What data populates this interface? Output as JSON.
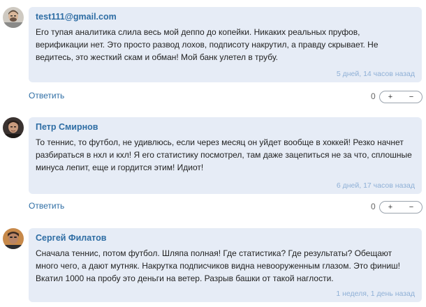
{
  "comments": [
    {
      "author": "test111@gmail.com",
      "text": "Его тупая аналитика слила весь мой деппо до копейки. Никаких реальных пруфов, верификации нет. Это просто развод лохов, подписоту накрутил, а правду скрывает. Не ведитесь, это жесткий скам и обман! Мой банк улетел в трубу.",
      "time": "5 дней, 14 часов назад",
      "reply_label": "Ответить",
      "score": "0",
      "upvote": "+",
      "downvote": "−"
    },
    {
      "author": "Петр Смирнов",
      "text": "То теннис, то футбол, не удивлюсь, если через месяц он уйдет вообще в хоккей! Резко начнет разбираться в нхл и кхл! Я его статистику посмотрел, там даже зацепиться не за что, сплошные минуса лепит, еще и гордится этим! Идиот!",
      "time": "6 дней, 17 часов назад",
      "reply_label": "Ответить",
      "score": "0",
      "upvote": "+",
      "downvote": "−"
    },
    {
      "author": "Сергей Филатов",
      "text": "Сначала теннис, потом футбол. Шляпа полная! Где статистика? Где результаты? Обещают много чего, а дают мутняк. Накрутка подписчиков видна невооруженным глазом. Это финиш! Вкатил 1000 на пробу это деньги на ветер. Разрыв башки от такой наглости.",
      "time": "1 неделя, 1 день назад"
    }
  ],
  "colors": {
    "bubble_bg": "#e6ecf6",
    "author": "#2e6da4",
    "timestamp": "#8fb0d6",
    "body_text": "#222222"
  }
}
